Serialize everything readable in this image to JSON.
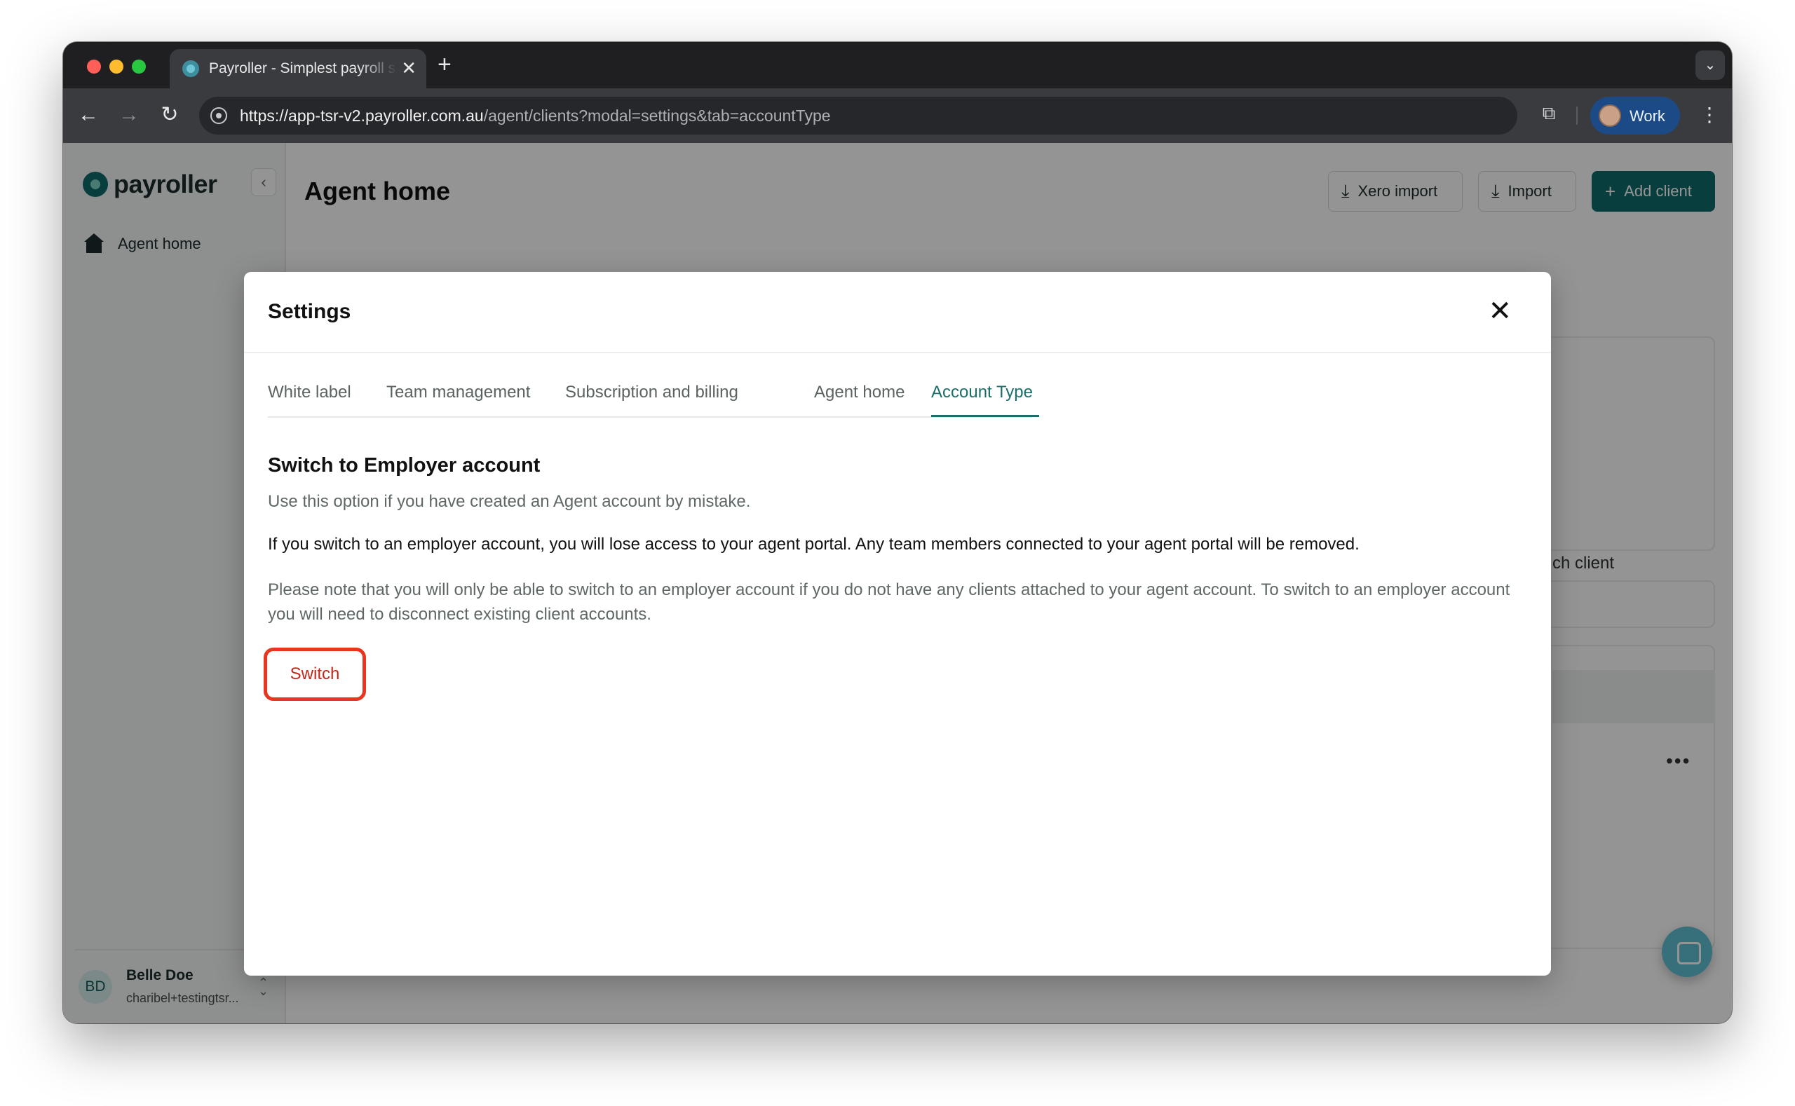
{
  "browser": {
    "tab_title": "Payroller - Simplest payroll software",
    "url_host": "https://app-tsr-v2.payroller.com.au",
    "url_path": "/agent/clients?modal=settings&tab=accountType",
    "profile_label": "Work",
    "new_tab_glyph": "+",
    "tab_close_glyph": "✕"
  },
  "sidebar": {
    "logo_text": "payroller",
    "nav_items": [
      {
        "label": "Agent home",
        "icon": "home-icon"
      }
    ],
    "user": {
      "initials": "BD",
      "name": "Belle Doe",
      "email": "charibel+testingtsr..."
    }
  },
  "main": {
    "title": "Agent home",
    "buttons": {
      "xero_import": "Xero import",
      "import": "Import",
      "add_client": "Add client"
    },
    "background_search_text": "ch client",
    "row_menu_glyph": "•••"
  },
  "modal": {
    "title": "Settings",
    "tabs": [
      {
        "label": "White label",
        "active": false
      },
      {
        "label": "Team management",
        "active": false
      },
      {
        "label": "Subscription and billing",
        "active": false
      },
      {
        "label": "Agent home",
        "active": false
      },
      {
        "label": "Account Type",
        "active": true
      }
    ],
    "section_title": "Switch to Employer account",
    "intro": "Use this option if you have created an Agent account by mistake.",
    "warning": "If you switch to an employer account, you will lose access to your agent portal. Any team members connected to your agent portal will be removed.",
    "note": "Please note that you will only be able to switch to an employer account if you do not have any clients attached to your agent account. To switch to an employer account you will need to disconnect existing client accounts.",
    "switch_label": "Switch"
  },
  "colors": {
    "brand": "#0f6b6b",
    "active_tab": "#1b6f68",
    "highlight": "#e8351f",
    "switch_text": "#c3261a"
  }
}
